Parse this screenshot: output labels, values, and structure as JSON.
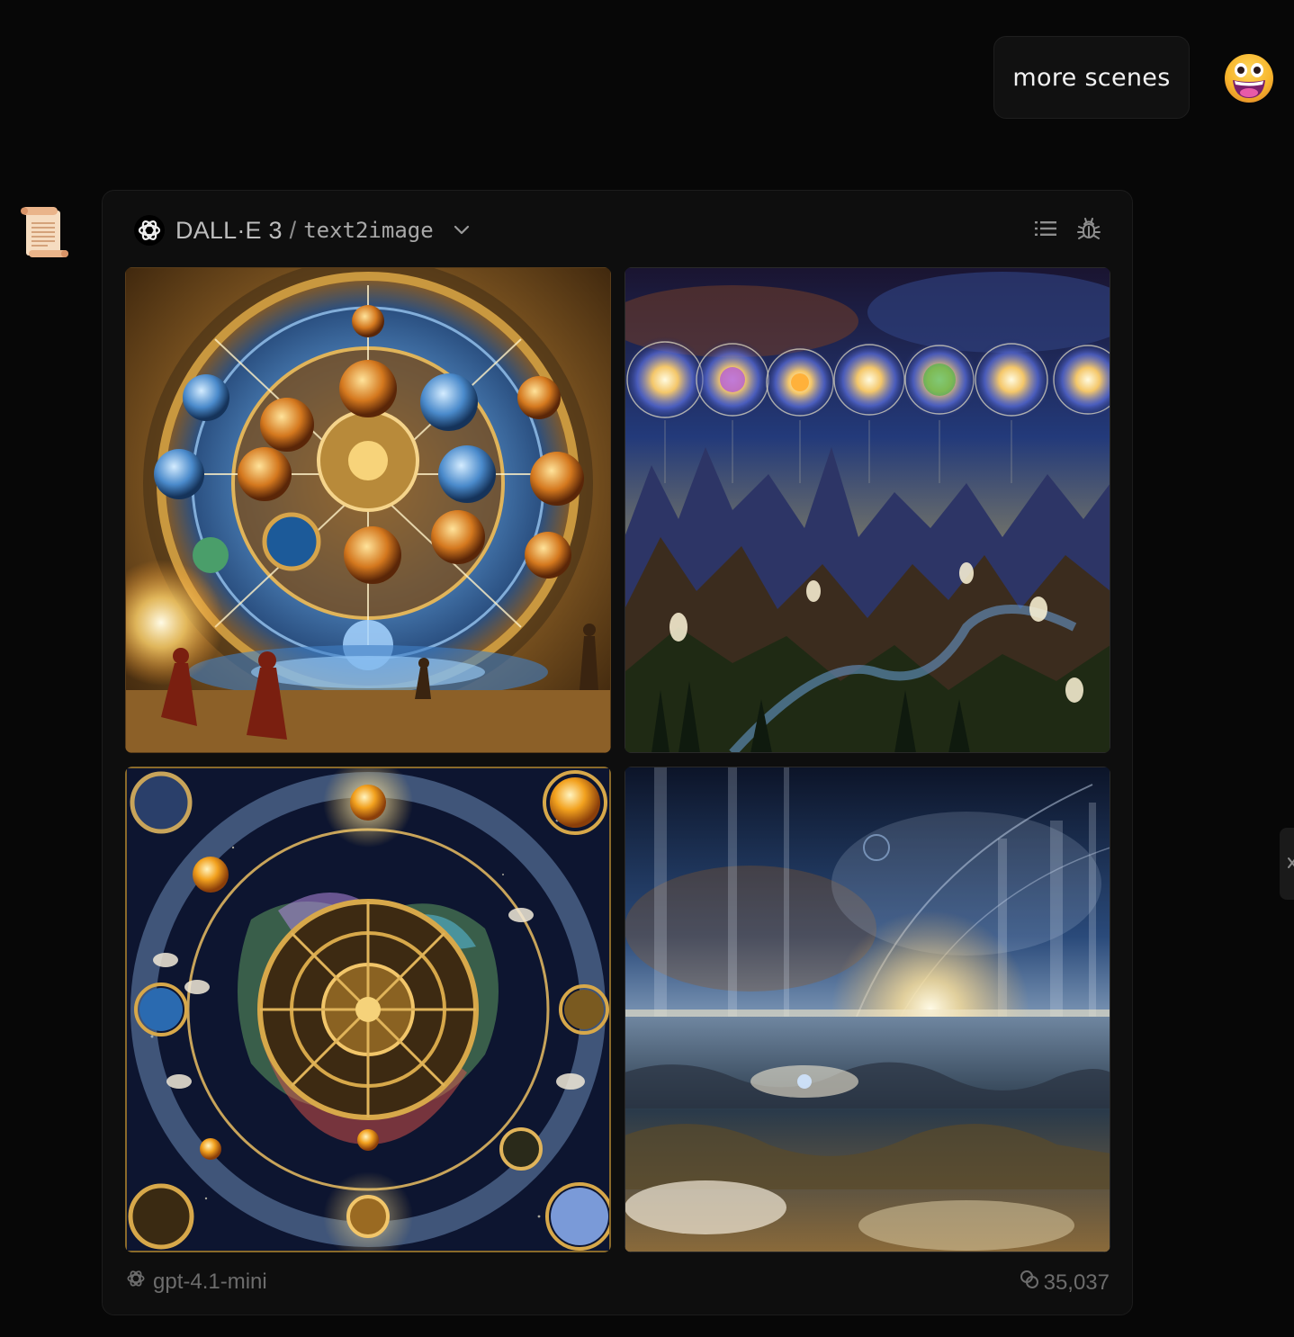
{
  "user_message": {
    "text": "more scenes",
    "avatar": "grinning-face-emoji"
  },
  "assistant": {
    "avatar": "scroll-emoji"
  },
  "plugin_card": {
    "provider": "DALL·E 3",
    "separator": "/",
    "tool": "text2image",
    "header_icons": [
      "list-icon",
      "bug-icon"
    ],
    "images": [
      {
        "name": "cosmic-clock-temple-image"
      },
      {
        "name": "galaxy-spirals-over-mountains-image"
      },
      {
        "name": "astronomical-clockwork-image"
      },
      {
        "name": "ethereal-sea-horizon-image"
      }
    ],
    "footer": {
      "model": "gpt-4.1-mini",
      "token_count": "35,037"
    }
  },
  "colors": {
    "background": "#070707",
    "card": "#0e0e0e",
    "bubble": "#111111",
    "muted_text": "#6c6c6c"
  }
}
